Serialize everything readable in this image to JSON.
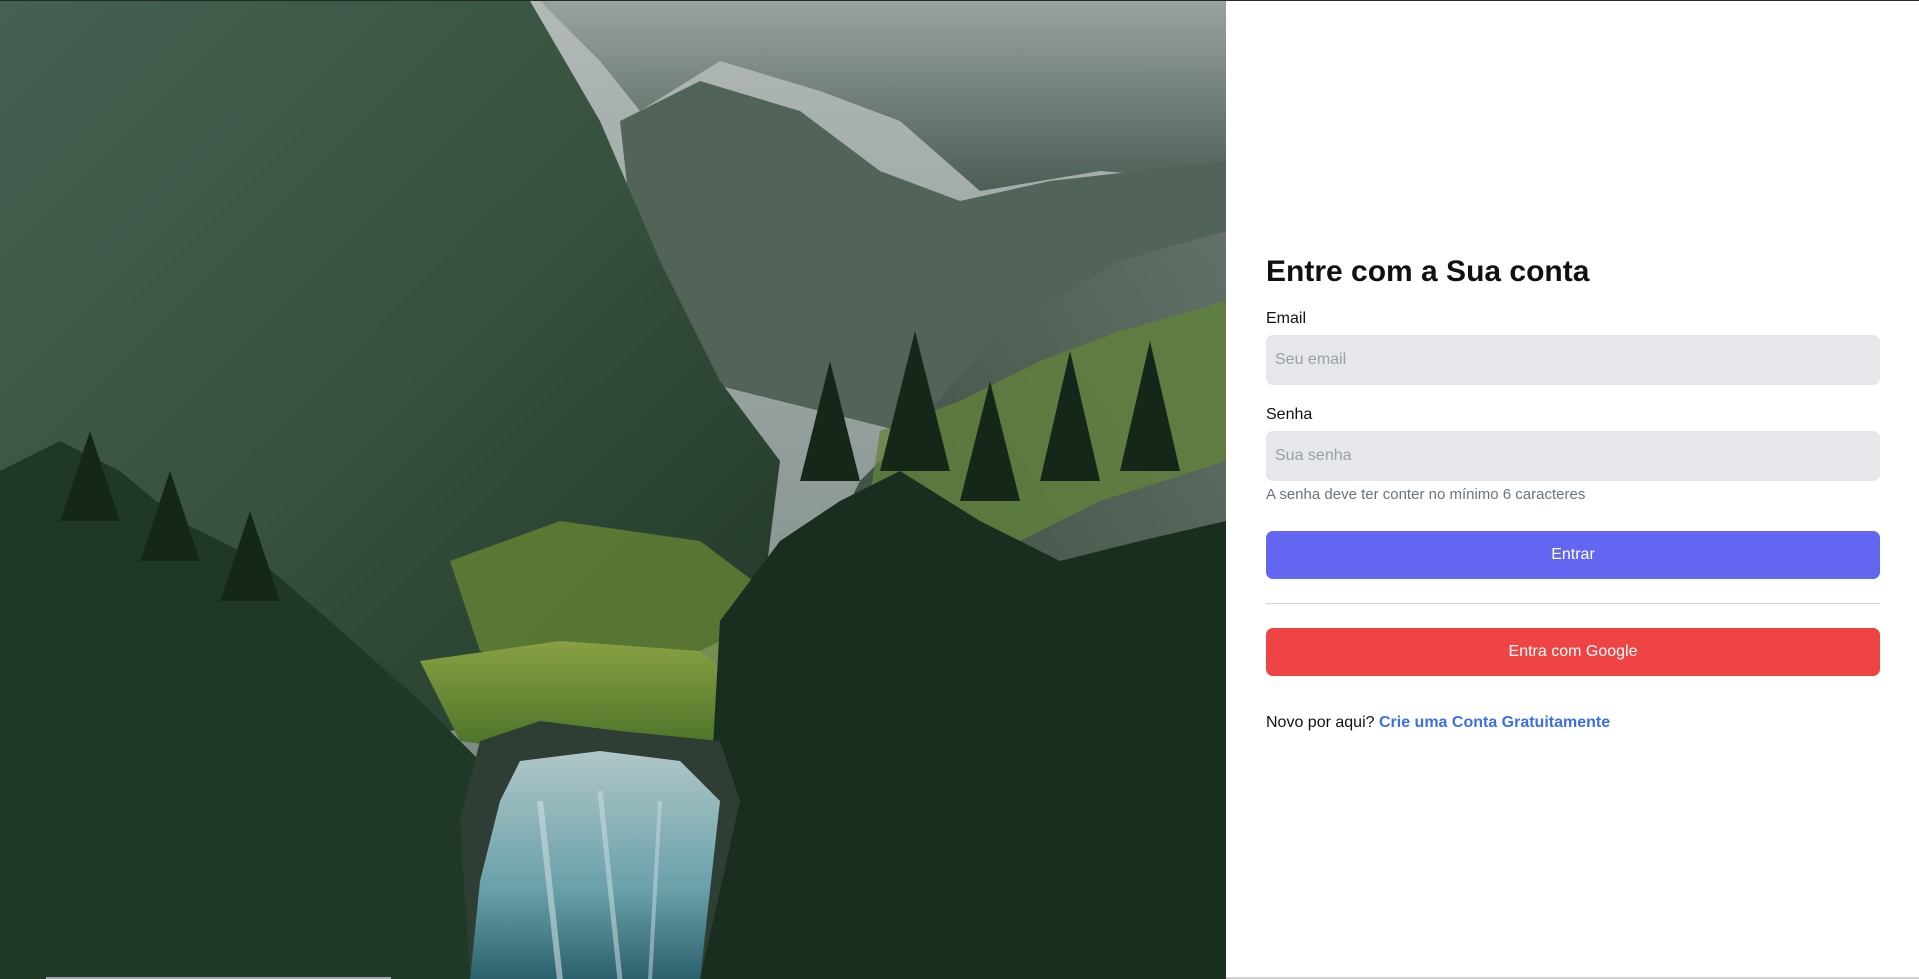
{
  "login": {
    "title": "Entre com a Sua conta",
    "email_label": "Email",
    "email_placeholder": "Seu email",
    "password_label": "Senha",
    "password_placeholder": "Sua senha",
    "password_hint": "A senha deve ter conter no mínimo 6 caracteres",
    "submit_label": "Entrar",
    "google_label": "Entra com Google",
    "signup_prompt": "Novo por aqui?",
    "signup_link": "Crie uma Conta Gratuitamente"
  },
  "colors": {
    "primary_button": "#6366f1",
    "google_button": "#ef4444",
    "link": "#3b6fe8",
    "input_bg": "#e5e7eb"
  },
  "hero": {
    "image_subject": "mountain-waterfall-landscape"
  }
}
